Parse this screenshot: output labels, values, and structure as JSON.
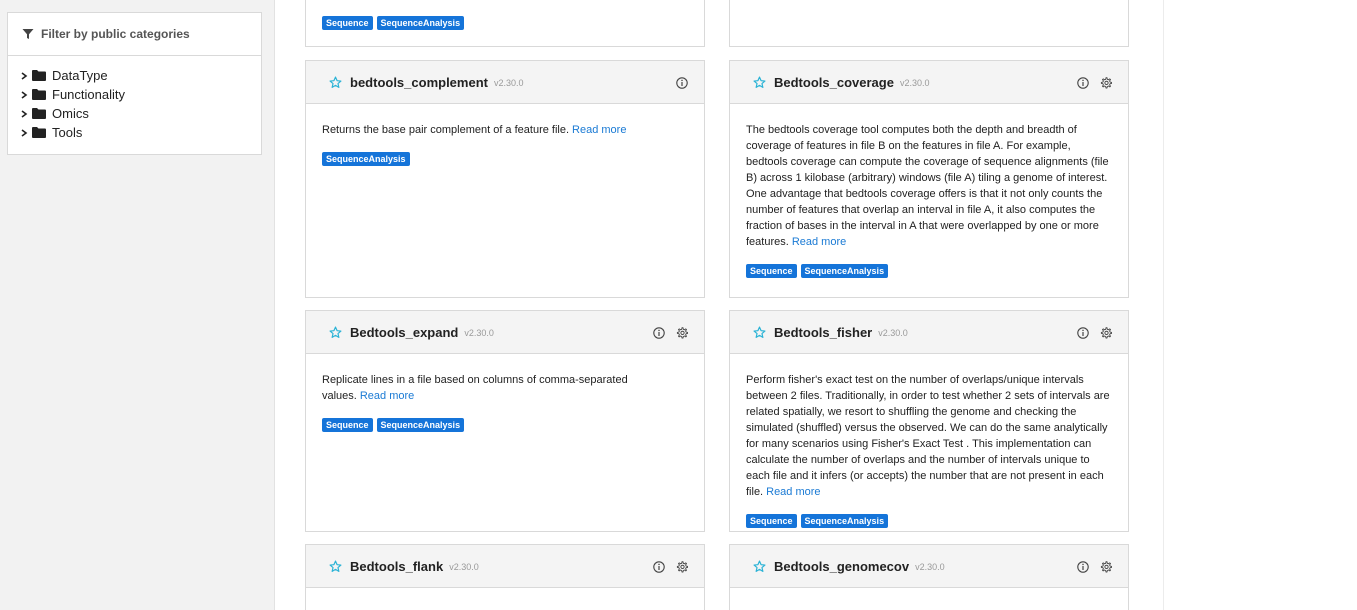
{
  "sidebar": {
    "filter_title": "Filter by public categories",
    "categories": [
      {
        "label": "DataType"
      },
      {
        "label": "Functionality"
      },
      {
        "label": "Omics"
      },
      {
        "label": "Tools"
      }
    ]
  },
  "read_more_label": "Read more",
  "cards": {
    "top_left": {
      "tags": [
        "Sequence",
        "SequenceAnalysis"
      ]
    },
    "complement": {
      "name": "bedtools_complement",
      "version": "v2.30.0",
      "description": "Returns the base pair complement of a feature file.",
      "tags": [
        "SequenceAnalysis"
      ]
    },
    "coverage": {
      "name": "Bedtools_coverage",
      "version": "v2.30.0",
      "description": "The bedtools coverage tool computes both the depth and breadth of coverage of features in file B on the features in file A. For example, bedtools coverage can compute the coverage of sequence alignments (file B) across 1 kilobase (arbitrary) windows (file A) tiling a genome of interest. One advantage that bedtools coverage offers is that it not only counts the number of features that overlap an interval in file A, it also computes the fraction of bases in the interval in A that were overlapped by one or more features.",
      "tags": [
        "Sequence",
        "SequenceAnalysis"
      ]
    },
    "expand": {
      "name": "Bedtools_expand",
      "version": "v2.30.0",
      "description": "Replicate lines in a file based on columns of comma-separated values.",
      "tags": [
        "Sequence",
        "SequenceAnalysis"
      ]
    },
    "fisher": {
      "name": "Bedtools_fisher",
      "version": "v2.30.0",
      "description": "Perform fisher's exact test on the number of overlaps/unique intervals between 2 files. Traditionally, in order to test whether 2 sets of intervals are related spatially, we resort to shuffling the genome and checking the simulated (shuffled) versus the observed. We can do the same analytically for many scenarios using Fisher's Exact Test . This implementation can calculate the number of overlaps and the number of intervals unique to each file and it infers (or accepts) the number that are not present in each file.",
      "tags": [
        "Sequence",
        "SequenceAnalysis"
      ]
    },
    "flank": {
      "name": "Bedtools_flank",
      "version": "v2.30.0"
    },
    "genomecov": {
      "name": "Bedtools_genomecov",
      "version": "v2.30.0"
    }
  },
  "colors": {
    "tag_bg": "#1574d9",
    "link": "#1a7ad4",
    "star": "#2bb3d6"
  },
  "icons": {
    "filter": "filter-icon",
    "folder": "folder-icon",
    "chevron": "chevron-right-icon",
    "star": "star-outline-icon",
    "info": "info-icon",
    "gear": "gear-icon"
  }
}
